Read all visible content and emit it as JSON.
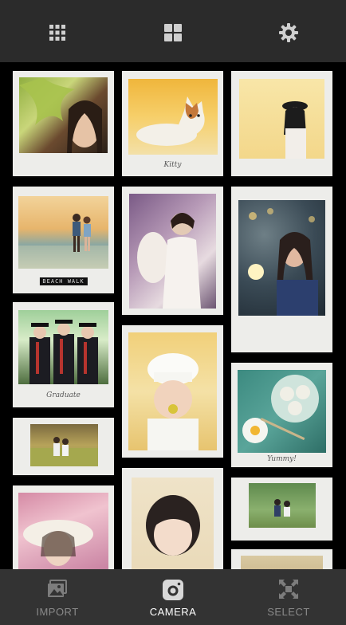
{
  "topbar": {
    "icons": [
      "apps-grid-icon",
      "collage-layout-icon",
      "settings-gear-icon"
    ]
  },
  "captions": {
    "kitty": "Kitty",
    "beach_walk": "BEACH WALK",
    "graduation": "Graduate",
    "food": "Yummy!"
  },
  "bottombar": {
    "import_label": "IMPORT",
    "camera_label": "CAMERA",
    "select_label": "SELECT"
  },
  "colors": {
    "topbar_bg": "#2b2b2b",
    "bottombar_bg": "#333333",
    "active_label": "#ffffff",
    "inactive_label": "#8a8a8a",
    "frame": "#ededea"
  }
}
